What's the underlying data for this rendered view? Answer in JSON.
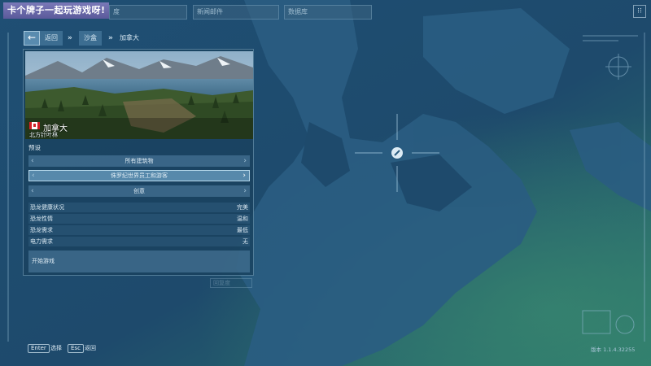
{
  "banner": {
    "text": "卡个牌子一起玩游戏呀!"
  },
  "top_tabs": [
    {
      "label": "度"
    },
    {
      "label": "新闻邮件"
    },
    {
      "label": "数据库"
    }
  ],
  "top_right_icon": "grid-icon",
  "breadcrumb": {
    "back_label": "返回",
    "items": [
      "沙盒",
      "加拿大"
    ],
    "separator": "»"
  },
  "location": {
    "name": "加拿大",
    "biome": "北方针叶林",
    "flag": "canada-flag-icon"
  },
  "presets": {
    "heading": "预设",
    "items": [
      {
        "label": "所有建筑物",
        "selected": false
      },
      {
        "label": "侏罗纪世界员工和游客",
        "selected": true
      },
      {
        "label": "创意",
        "selected": false
      }
    ]
  },
  "stats": [
    {
      "key": "恐龙健康状况",
      "value": "完美"
    },
    {
      "key": "恐龙性情",
      "value": "温和"
    },
    {
      "key": "恐龙需求",
      "value": "最低"
    },
    {
      "key": "电力需求",
      "value": "无"
    }
  ],
  "start_label": "开始游戏",
  "ghost_label": "回复度",
  "hints": [
    {
      "key": "Enter",
      "label": "选择"
    },
    {
      "key": "Esc",
      "label": "返回"
    }
  ],
  "version": "版本 1.1.4.32255",
  "colors": {
    "accent": "#6ea0c3",
    "panel": "#1a4260",
    "banner": "#6b6aa9"
  }
}
